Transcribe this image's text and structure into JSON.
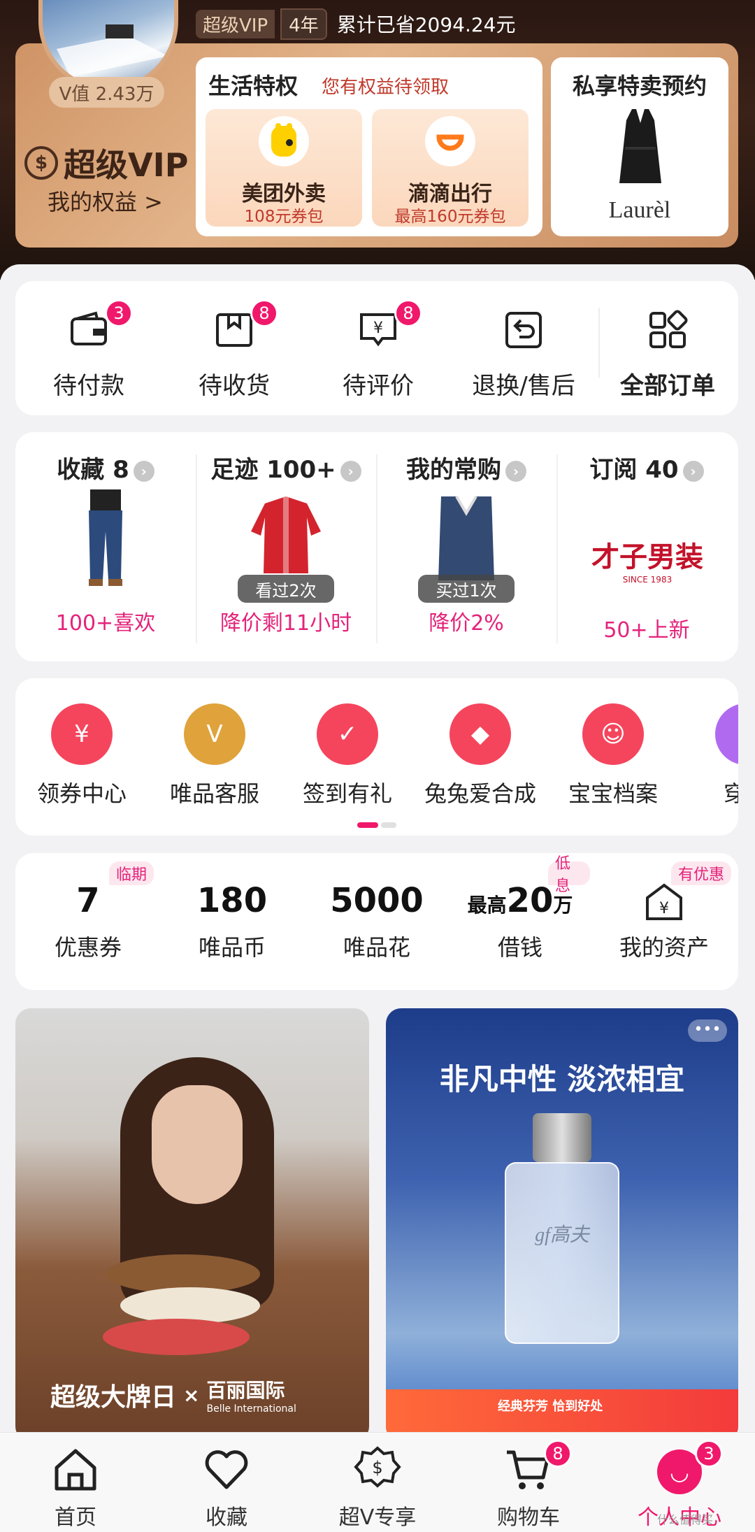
{
  "header": {
    "v_value": "V值 2.43万",
    "svip_tag": "超级VIP",
    "years_tag": "4年",
    "saved_text": "累计已省2094.24元",
    "vip_logo_text": "超级VIP",
    "my_rights": "我的权益 >",
    "life_title": "生活特权",
    "life_subtitle": "您有权益待领取",
    "coupons": [
      {
        "name": "美团外卖",
        "desc": "108元券包",
        "icon": "meituan-icon"
      },
      {
        "name": "滴滴出行",
        "desc": "最高160元券包",
        "icon": "didi-icon"
      }
    ],
    "sale_title": "私享特卖预约",
    "sale_brand": "Laurèl"
  },
  "orders": [
    {
      "label": "待付款",
      "badge": "3",
      "icon": "wallet-icon"
    },
    {
      "label": "待收货",
      "badge": "8",
      "icon": "package-icon"
    },
    {
      "label": "待评价",
      "badge": "8",
      "icon": "review-icon"
    },
    {
      "label": "退换/售后",
      "badge": "",
      "icon": "return-icon"
    },
    {
      "label": "全部订单",
      "badge": "",
      "icon": "all-orders-icon"
    }
  ],
  "collections": [
    {
      "title": "收藏 8",
      "tag": "",
      "foot": "100+喜欢"
    },
    {
      "title": "足迹 100+",
      "tag": "看过2次",
      "foot": "降价剩11小时"
    },
    {
      "title": "我的常购",
      "tag": "买过1次",
      "foot": "降价2%"
    },
    {
      "title": "订阅 40",
      "tag": "",
      "foot": "50+上新",
      "brand": "才子男装",
      "brand_sub": "SINCE 1983"
    }
  ],
  "services": [
    {
      "label": "领券中心",
      "icon": "coupon-center-icon",
      "color": "#f5455d",
      "glyph": "¥"
    },
    {
      "label": "唯品客服",
      "icon": "customer-service-icon",
      "color": "#e0a23a",
      "glyph": "V"
    },
    {
      "label": "签到有礼",
      "icon": "checkin-icon",
      "color": "#f5455d",
      "glyph": "✓"
    },
    {
      "label": "兔兔爱合成",
      "icon": "bag-icon",
      "color": "#f5455d",
      "glyph": "◆"
    },
    {
      "label": "宝宝档案",
      "icon": "baby-icon",
      "color": "#f5455d",
      "glyph": "☺"
    },
    {
      "label": "穿上",
      "icon": "partial-icon",
      "color": "#b06af0",
      "glyph": ""
    }
  ],
  "assets": [
    {
      "num": "7",
      "label": "优惠券",
      "tag": "临期"
    },
    {
      "num": "180",
      "label": "唯品币",
      "tag": ""
    },
    {
      "num": "5000",
      "label": "唯品花",
      "tag": ""
    },
    {
      "num_prefix": "最高",
      "num": "20",
      "num_suffix": "万",
      "label": "借钱",
      "tag": "低息"
    },
    {
      "num": "",
      "label": "我的资产",
      "tag": "有优惠"
    }
  ],
  "banners": {
    "left_caption": "超级大牌日",
    "left_partner": "百丽国际",
    "left_partner_en": "Belle International",
    "right_title": "非凡中性 淡浓相宜",
    "right_brand": "gf高夫",
    "right_strip": "经典芬芳 恰到好处"
  },
  "tabs": [
    {
      "label": "首页",
      "icon": "home-icon"
    },
    {
      "label": "收藏",
      "icon": "heart-icon"
    },
    {
      "label": "超V专享",
      "icon": "svip-icon"
    },
    {
      "label": "购物车",
      "icon": "cart-icon",
      "badge": "8"
    },
    {
      "label": "个人中心",
      "icon": "profile-icon",
      "badge": "3"
    }
  ],
  "watermark": "什么值得买"
}
